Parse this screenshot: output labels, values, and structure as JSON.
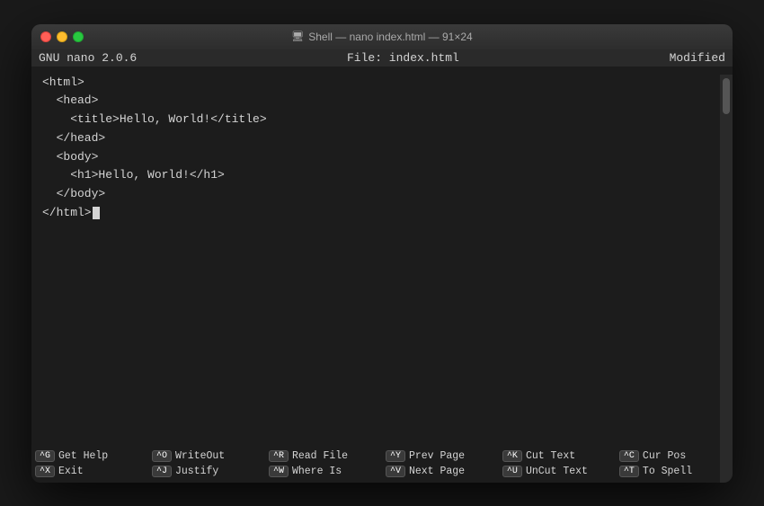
{
  "window": {
    "title": "Shell — nano index.html — 91×24",
    "shell_icon": "🖥"
  },
  "nano": {
    "header": {
      "left": "GNU nano 2.0.6",
      "center": "File: index.html",
      "right": "Modified"
    },
    "code_lines": [
      "<html>",
      "  <head>",
      "    <title>Hello, World!</title>",
      "  </head>",
      "  <body>",
      "    <h1>Hello, World!</h1>",
      "  </body>",
      "</html>"
    ],
    "shortcuts": [
      [
        {
          "key": "^G",
          "label": "Get Help"
        },
        {
          "key": "^O",
          "label": "WriteOut"
        },
        {
          "key": "^R",
          "label": "Read File"
        },
        {
          "key": "^Y",
          "label": "Prev Page"
        },
        {
          "key": "^K",
          "label": "Cut Text"
        },
        {
          "key": "^C",
          "label": "Cur Pos"
        }
      ],
      [
        {
          "key": "^X",
          "label": "Exit"
        },
        {
          "key": "^J",
          "label": "Justify"
        },
        {
          "key": "^W",
          "label": "Where Is"
        },
        {
          "key": "^V",
          "label": "Next Page"
        },
        {
          "key": "^U",
          "label": "UnCut Text"
        },
        {
          "key": "^T",
          "label": "To Spell"
        }
      ]
    ]
  }
}
